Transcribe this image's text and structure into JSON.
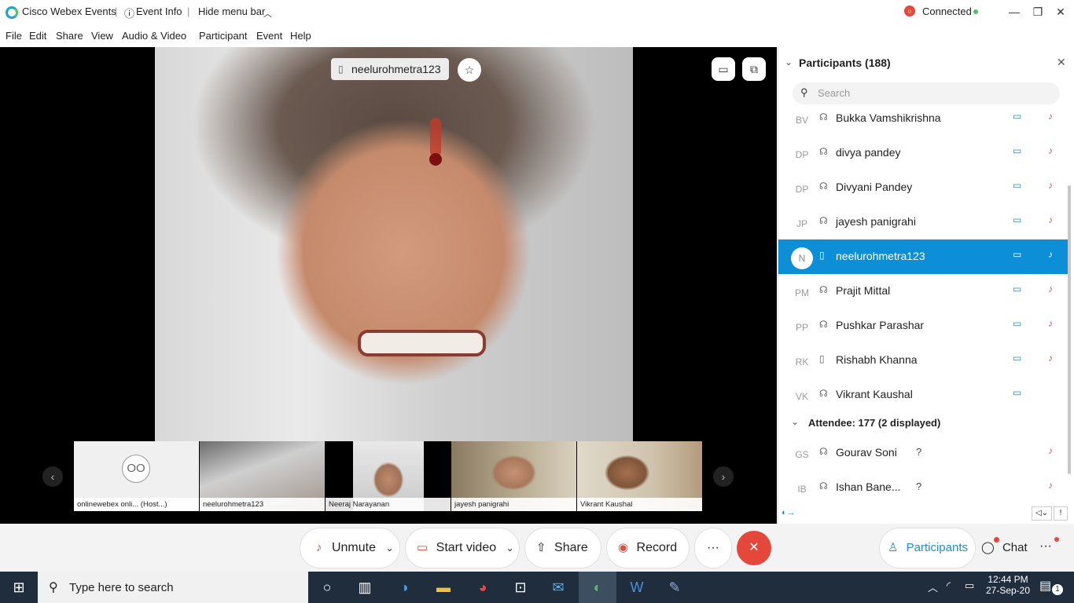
{
  "titlebar": {
    "app_title": "Cisco Webex Events",
    "event_info": "Event Info",
    "hide_menu": "Hide menu bar",
    "connected": "Connected",
    "min_glyph": "—",
    "max_glyph": "❐",
    "close_glyph": "✕"
  },
  "menu": [
    "File",
    "Edit",
    "Share",
    "View",
    "Audio & Video",
    "Participant",
    "Event",
    "Help"
  ],
  "main_video": {
    "name": "neelurohmetra123"
  },
  "thumbnails": [
    {
      "initials": "OO",
      "label": "onlinewebex onli... (Host...)"
    },
    {
      "label": "neelurohmetra123"
    },
    {
      "label": "Neeraj Narayanan"
    },
    {
      "label": "jayesh panigrahi"
    },
    {
      "label": "Vikrant Kaushal"
    }
  ],
  "panel": {
    "title": "Participants (188)",
    "search_placeholder": "Search",
    "panelists": [
      {
        "initials": "BV",
        "name": "Bukka Vamshikrishna"
      },
      {
        "initials": "DP",
        "name": "divya pandey"
      },
      {
        "initials": "DP",
        "name": "Divyani Pandey"
      },
      {
        "initials": "JP",
        "name": "jayesh panigrahi"
      },
      {
        "initials": "N",
        "name": "neelurohmetra123",
        "selected": true
      },
      {
        "initials": "PM",
        "name": "Prajit Mittal"
      },
      {
        "initials": "PP",
        "name": "Pushkar Parashar"
      },
      {
        "initials": "RK",
        "name": "Rishabh Khanna"
      },
      {
        "initials": "VK",
        "name": "Vikrant Kaushal"
      }
    ],
    "attendee_header": "Attendee: 177 (2 displayed)",
    "attendees": [
      {
        "initials": "GS",
        "name": "Gourav Soni",
        "status": "?"
      },
      {
        "initials": "IB",
        "name": "Ishan Bane...",
        "status": "?"
      }
    ]
  },
  "controls": {
    "unmute": "Unmute",
    "start_video": "Start video",
    "share": "Share",
    "record": "Record",
    "more": "···",
    "end": "✕",
    "participants": "Participants",
    "chat": "Chat"
  },
  "taskbar": {
    "search_placeholder": "Type here to search",
    "time": "12:44 PM",
    "date": "27-Sep-20",
    "notifications": "1"
  },
  "colors": {
    "accent": "#0c8fd7",
    "end_call": "#e5483b",
    "connected_dot": "#4fc35d"
  }
}
